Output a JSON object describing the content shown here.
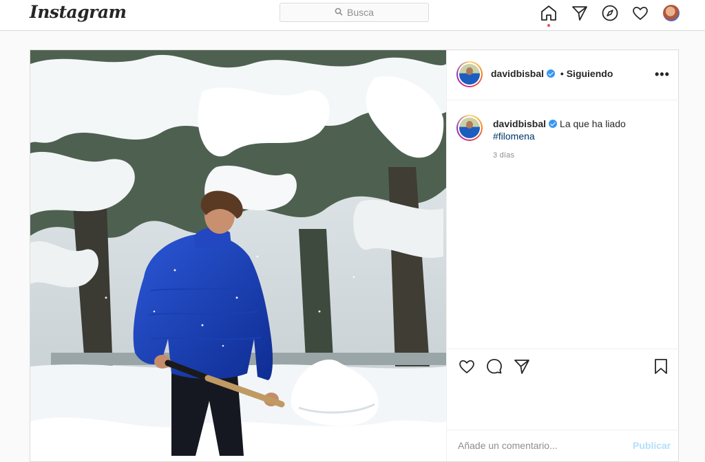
{
  "nav": {
    "logo": "Instagram",
    "search_placeholder": "Busca",
    "icons": [
      "home-icon",
      "direct-icon",
      "explore-icon",
      "activity-icon",
      "profile-avatar"
    ]
  },
  "post": {
    "username": "davidbisbal",
    "follow_status": "• Siguiendo",
    "caption": {
      "username": "davidbisbal",
      "text": "La que ha liado",
      "hashtag": "#filomena"
    },
    "time_ago": "3 días",
    "comment_placeholder": "Añade un comentario...",
    "publish_label": "Publicar"
  },
  "colors": {
    "accent_blue": "#3897f0",
    "notification_dot": "#ed4956",
    "publish_disabled": "#b2dffc"
  }
}
